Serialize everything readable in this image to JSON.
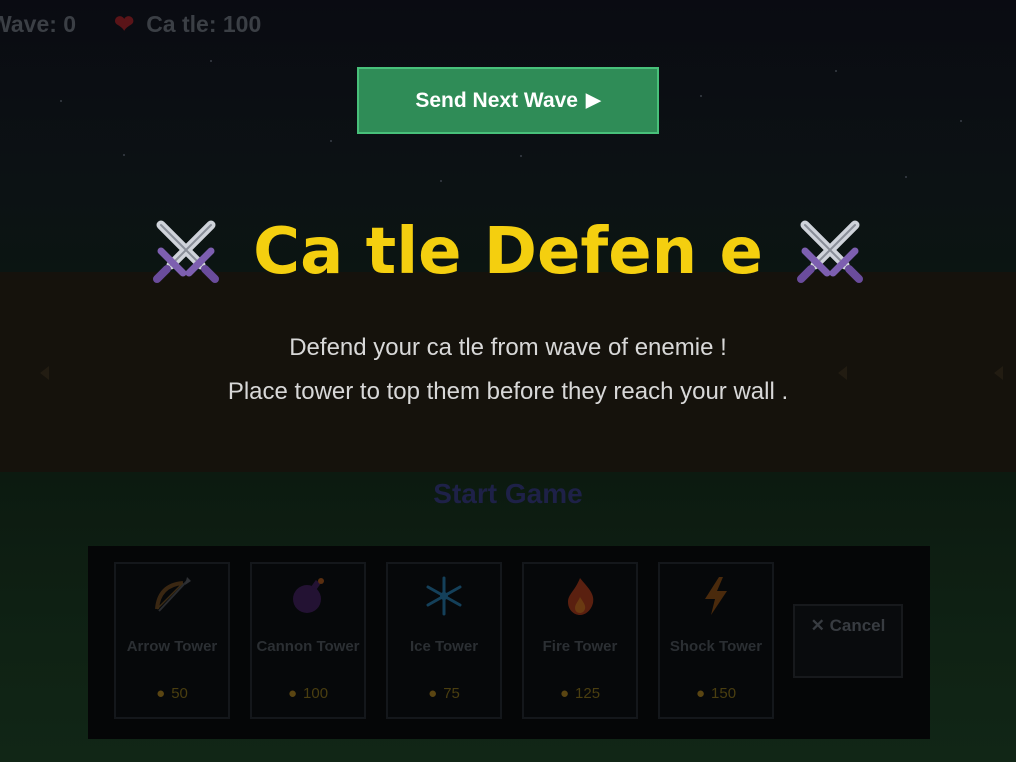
{
  "hud": {
    "wave_text": "Wave: 0",
    "heart_icon": "❤",
    "castle_text": "Ca tle: 100"
  },
  "send_wave": {
    "label": "Send Next Wave",
    "play_icon": "▶"
  },
  "intro": {
    "title": "Ca tle Defen e",
    "title_icon": "crossed-swords-icon",
    "line1": "Defend your ca tle from wave  of enemie !",
    "line2": "Place tower  to  top them before they reach your wall .",
    "start_label": "Start Game"
  },
  "towers": [
    {
      "name": "Arrow Tower",
      "cost": "50",
      "icon": "bow-arrow-icon"
    },
    {
      "name": "Cannon Tower",
      "cost": "100",
      "icon": "bomb-icon"
    },
    {
      "name": "Ice Tower",
      "cost": "75",
      "icon": "snowflake-icon"
    },
    {
      "name": "Fire Tower",
      "cost": "125",
      "icon": "fire-icon"
    },
    {
      "name": "Shock Tower",
      "cost": "150",
      "icon": "lightning-icon"
    }
  ],
  "cost_icon": "money-bag-icon",
  "cancel": {
    "label": "✕ Cancel"
  },
  "colors": {
    "title": "#f4cf0f",
    "send_button": "#2f8c57",
    "start_text": "#1e2148"
  }
}
